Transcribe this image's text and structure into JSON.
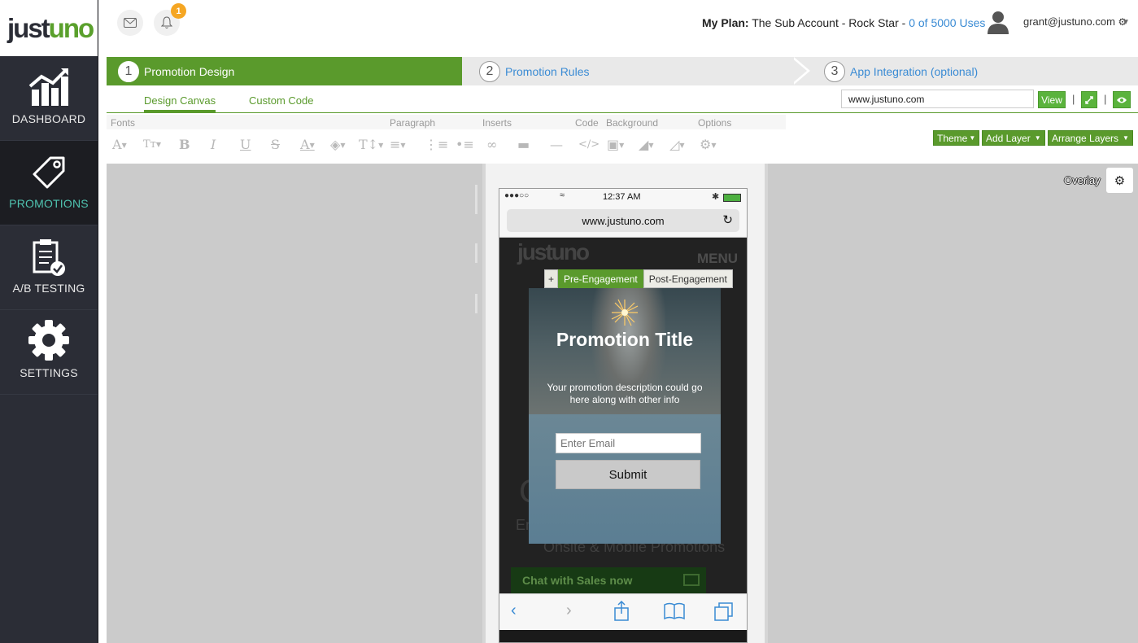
{
  "brand": {
    "logo_just": "just",
    "logo_uno": "uno"
  },
  "sidebar": {
    "items": [
      {
        "label": "DASHBOARD",
        "icon": "chart-icon"
      },
      {
        "label": "PROMOTIONS",
        "icon": "tag-icon",
        "active": true
      },
      {
        "label": "A/B TESTING",
        "icon": "clipboard-check-icon"
      },
      {
        "label": "SETTINGS",
        "icon": "gear-icon"
      }
    ]
  },
  "header": {
    "notification_count": "1",
    "plan_label": "My Plan:",
    "plan_name": "The Sub Account - Rock Star -",
    "plan_uses": "0 of 5000 Uses",
    "user_email": "grant@justuno.com"
  },
  "steps": [
    {
      "num": "1",
      "label": "Promotion Design"
    },
    {
      "num": "2",
      "label": "Promotion Rules"
    },
    {
      "num": "3",
      "label": "App Integration (optional)"
    }
  ],
  "subtabs": {
    "design_canvas": "Design Canvas",
    "custom_code": "Custom Code"
  },
  "preview": {
    "url": "www.justuno.com",
    "view_label": "View"
  },
  "toolbar": {
    "groups": [
      "Fonts",
      "Paragraph",
      "Inserts",
      "Code",
      "Background",
      "Options"
    ],
    "theme_label": "Theme",
    "add_layer_label": "Add Layer",
    "arrange_layers_label": "Arrange Layers"
  },
  "canvas": {
    "overlay_label": "Overlay"
  },
  "phone": {
    "time": "12:37 AM",
    "url": "www.justuno.com",
    "site_logo": "justuno",
    "site_menu": "MENU",
    "site_big_text": "C                     l",
    "site_sub_text": "En                           th",
    "site_sub2_text": "Onsite & Mobile Promotions",
    "chat_label": "Chat with Sales now"
  },
  "popup": {
    "tab_plus": "+",
    "tab_pre": "Pre-Engagement",
    "tab_post": "Post-Engagement",
    "title": "Promotion Title",
    "description": "Your promotion description could go here along with other info",
    "email_placeholder": "Enter Email",
    "submit_label": "Submit"
  },
  "colors": {
    "accent_green": "#5a9a2c",
    "link_blue": "#3a8bd4",
    "sidebar_bg": "#2b2d36",
    "active_teal": "#4fc3b0",
    "badge_orange": "#f5a623"
  }
}
